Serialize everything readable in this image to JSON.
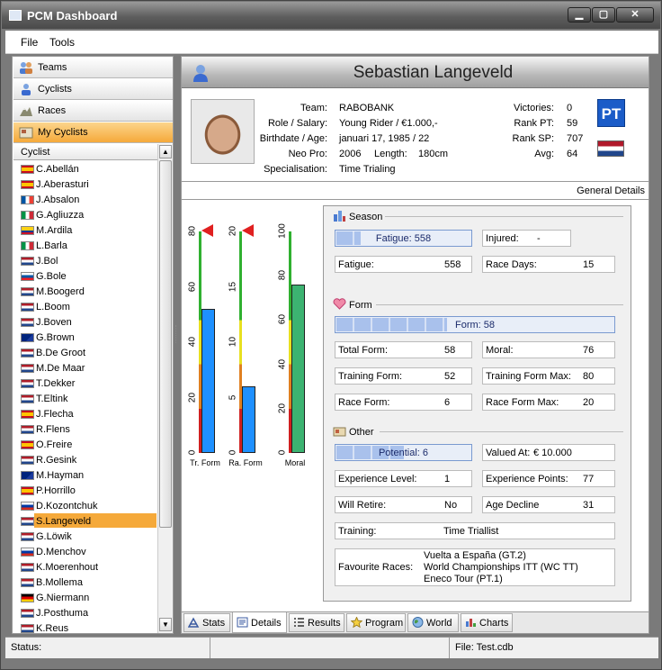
{
  "window": {
    "title": "PCM Dashboard"
  },
  "menu": [
    "File",
    "Tools"
  ],
  "nav": [
    {
      "label": "Teams",
      "icon": "teams-icon"
    },
    {
      "label": "Cyclists",
      "icon": "cyclists-icon"
    },
    {
      "label": "Races",
      "icon": "races-icon"
    },
    {
      "label": "My Cyclists",
      "icon": "my-cyclists-icon"
    }
  ],
  "list": {
    "header": "Cyclist",
    "items": [
      {
        "name": "C.Abellán",
        "flag": "es"
      },
      {
        "name": "J.Aberasturi",
        "flag": "es"
      },
      {
        "name": "J.Absalon",
        "flag": "fr"
      },
      {
        "name": "G.Agliuzza",
        "flag": "it"
      },
      {
        "name": "M.Ardila",
        "flag": "co"
      },
      {
        "name": "L.Barla",
        "flag": "it"
      },
      {
        "name": "J.Bol",
        "flag": "nl"
      },
      {
        "name": "G.Bole",
        "flag": "si"
      },
      {
        "name": "M.Boogerd",
        "flag": "nl"
      },
      {
        "name": "L.Boom",
        "flag": "nl"
      },
      {
        "name": "J.Boven",
        "flag": "nl"
      },
      {
        "name": "G.Brown",
        "flag": "au"
      },
      {
        "name": "B.De Groot",
        "flag": "nl"
      },
      {
        "name": "M.De Maar",
        "flag": "nl"
      },
      {
        "name": "T.Dekker",
        "flag": "nl"
      },
      {
        "name": "T.Eltink",
        "flag": "nl"
      },
      {
        "name": "J.Flecha",
        "flag": "es"
      },
      {
        "name": "R.Flens",
        "flag": "nl"
      },
      {
        "name": "O.Freire",
        "flag": "es"
      },
      {
        "name": "R.Gesink",
        "flag": "nl"
      },
      {
        "name": "M.Hayman",
        "flag": "au"
      },
      {
        "name": "P.Horrillo",
        "flag": "es"
      },
      {
        "name": "D.Kozontchuk",
        "flag": "ru"
      },
      {
        "name": "S.Langeveld",
        "flag": "nl",
        "selected": true
      },
      {
        "name": "G.Löwik",
        "flag": "nl"
      },
      {
        "name": "D.Menchov",
        "flag": "ru"
      },
      {
        "name": "K.Moerenhout",
        "flag": "nl"
      },
      {
        "name": "B.Mollema",
        "flag": "nl"
      },
      {
        "name": "G.Niermann",
        "flag": "de"
      },
      {
        "name": "J.Posthuma",
        "flag": "nl"
      },
      {
        "name": "K.Reus",
        "flag": "nl"
      }
    ]
  },
  "header": {
    "name": "Sebastian Langeveld"
  },
  "info": {
    "left": [
      {
        "label": "Team:",
        "value": "RABOBANK"
      },
      {
        "label": "Role / Salary:",
        "value": "Young Rider / €1.000,-"
      },
      {
        "label": "Birthdate / Age:",
        "value": "januari 17, 1985 / 22"
      },
      {
        "label": "Neo Pro:",
        "value": "2006",
        "label2": "Length:",
        "value2": "180cm"
      },
      {
        "label": "Specialisation:",
        "value": "Time Trialing"
      }
    ],
    "right": [
      {
        "label": "Victories:",
        "value": "0"
      },
      {
        "label": "Rank PT:",
        "value": "59"
      },
      {
        "label": "Rank SP:",
        "value": "707"
      },
      {
        "label": "Avg:",
        "value": "64"
      }
    ],
    "team_badge": "PT"
  },
  "general_details": "General Details",
  "gauges": [
    {
      "label": "Tr. Form",
      "ticks": [
        "80",
        "60",
        "40",
        "20",
        "0"
      ],
      "max": 80,
      "value": 52,
      "color": "#1e90ff"
    },
    {
      "label": "Ra. Form",
      "ticks": [
        "20",
        "15",
        "10",
        "5",
        "0"
      ],
      "max": 20,
      "value": 6,
      "color": "#1e90ff"
    },
    {
      "label": "Moral",
      "ticks": [
        "100",
        "80",
        "60",
        "40",
        "20",
        "0"
      ],
      "max": 100,
      "value": 76,
      "color": "#3cb371"
    }
  ],
  "season": {
    "title": "Season",
    "fatigue_bar": "Fatigue: 558",
    "fatigue_pct": 0.18,
    "injured_label": "Injured:",
    "injured_value": "-",
    "fatigue_label": "Fatigue:",
    "fatigue_value": "558",
    "race_days_label": "Race Days:",
    "race_days_value": "15"
  },
  "form": {
    "title": "Form",
    "form_bar": "Form: 58",
    "form_pct": 0.4,
    "total_form_label": "Total Form:",
    "total_form_value": "58",
    "moral_label": "Moral:",
    "moral_value": "76",
    "training_form_label": "Training Form:",
    "training_form_value": "52",
    "training_form_max_label": "Training Form Max:",
    "training_form_max_value": "80",
    "race_form_label": "Race Form:",
    "race_form_value": "6",
    "race_form_max_label": "Race Form Max:",
    "race_form_max_value": "20"
  },
  "other": {
    "title": "Other",
    "potential_bar": "Potential: 6",
    "potential_pct": 0.5,
    "valued_at_label": "Valued At:",
    "valued_at_value": "€ 10.000",
    "experience_level_label": "Experience Level:",
    "experience_level_value": "1",
    "experience_points_label": "Experience Points:",
    "experience_points_value": "77",
    "will_retire_label": "Will Retire:",
    "will_retire_value": "No",
    "age_decline_label": "Age Decline",
    "age_decline_value": "31",
    "training_label": "Training:",
    "training_value": "Time Triallist",
    "favourite_races_label": "Favourite Races:",
    "favourite_races": [
      "Vuelta a España (GT.2)",
      "World Championships ITT (WC TT)",
      "Eneco Tour (PT.1)"
    ]
  },
  "tabs": [
    {
      "label": "Stats",
      "icon": "stats-icon"
    },
    {
      "label": "Details",
      "icon": "details-icon",
      "active": true
    },
    {
      "label": "Results",
      "icon": "results-icon"
    },
    {
      "label": "Program",
      "icon": "program-icon"
    },
    {
      "label": "World",
      "icon": "world-icon"
    },
    {
      "label": "Charts",
      "icon": "charts-icon"
    }
  ],
  "status": {
    "label": "Status:",
    "file": "File: Test.cdb"
  }
}
